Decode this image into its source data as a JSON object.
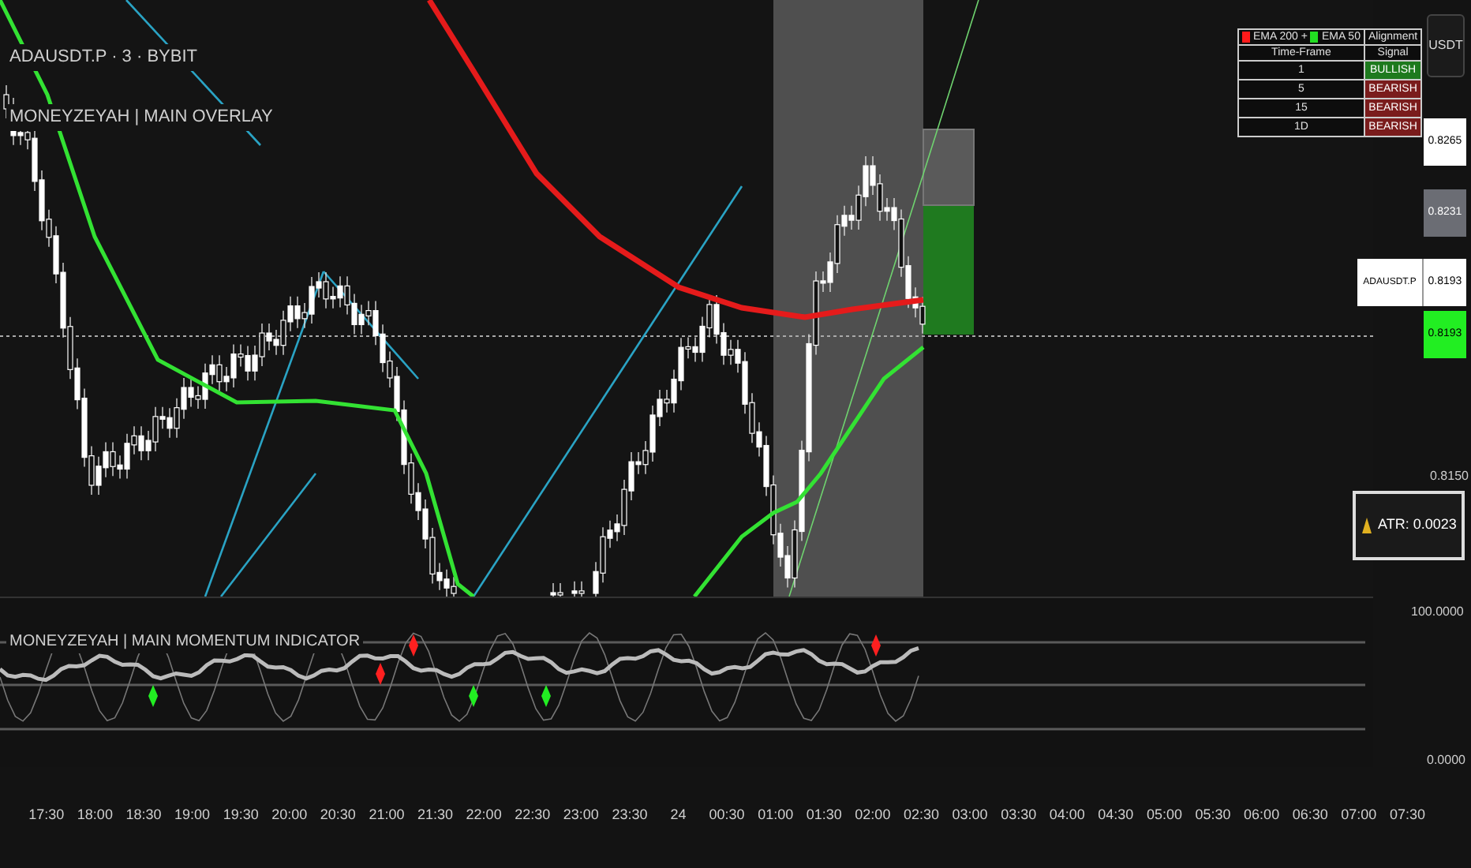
{
  "chart": {
    "symbol_title": "ADAUSDT.P · 3 · BYBIT",
    "overlay_title": "MONEYZEYAH | MAIN OVERLAY"
  },
  "alignment_table": {
    "legend": [
      {
        "label": "EMA 200 +",
        "color": "#ff1a1a"
      },
      {
        "label": "EMA 50",
        "color": "#22dd22"
      }
    ],
    "title": "Alignment",
    "columns": [
      "Time-Frame",
      "Signal"
    ],
    "rows": [
      {
        "timeframe": "1",
        "signal": "BULLISH",
        "color": "#1e7a1e"
      },
      {
        "timeframe": "5",
        "signal": "BEARISH",
        "color": "#7a1c1c"
      },
      {
        "timeframe": "15",
        "signal": "BEARISH",
        "color": "#7a1c1c"
      },
      {
        "timeframe": "1D",
        "signal": "BEARISH",
        "color": "#7a1c1c"
      }
    ]
  },
  "atr_label": "ATR: 0.0023",
  "price_axis": {
    "currency_button": "USDT",
    "tags": [
      {
        "kind": "plain",
        "text": "0.8265"
      },
      {
        "kind": "muted",
        "text": "0.8231"
      },
      {
        "kind": "symbol",
        "label": "ADAUSDT.P",
        "text": "0.8193"
      },
      {
        "kind": "last",
        "text": "0.8193"
      },
      {
        "kind": "tick",
        "text": "0.8150"
      }
    ]
  },
  "oscillator": {
    "title": "MONEYZEYAH | MAIN MOMENTUM INDICATOR",
    "scale": [
      "100.0000",
      "0.0000"
    ]
  },
  "time_axis": [
    "17:30",
    "18:00",
    "18:30",
    "19:00",
    "19:30",
    "20:00",
    "20:30",
    "21:00",
    "21:30",
    "22:00",
    "22:30",
    "23:00",
    "23:30",
    "24",
    "00:30",
    "01:00",
    "01:30",
    "02:00",
    "02:30",
    "03:00",
    "03:30",
    "04:00",
    "04:30",
    "05:00",
    "05:30",
    "06:00",
    "06:30",
    "07:00",
    "07:30"
  ]
}
